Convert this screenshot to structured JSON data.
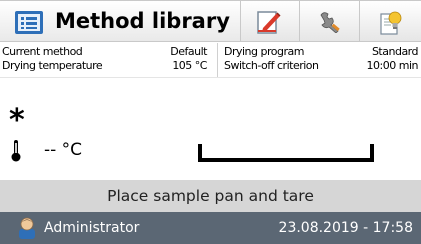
{
  "toolbar": {
    "title": "Method library",
    "icons": [
      "method-library-icon",
      "edit-pencil-icon",
      "wrench-icon",
      "info-bulb-icon"
    ]
  },
  "info_panel": {
    "current_method_label": "Current method",
    "current_method_value": "Default",
    "drying_temperature_label": "Drying temperature",
    "drying_temperature_value": "105 °C",
    "drying_program_label": "Drying program",
    "drying_program_value": "Standard",
    "switch_off_label": "Switch-off criterion",
    "switch_off_value": "10:00 min"
  },
  "main": {
    "asterisk": "*",
    "temperature_reading": "-- °C"
  },
  "instruction": "Place sample pan and tare",
  "status_bar": {
    "user": "Administrator",
    "datetime": "23.08.2019 - 17:58"
  },
  "colors": {
    "status_bar_bg": "#5b6774",
    "instruction_bg": "#d6d6d6",
    "edit_icon_red": "#d93a2b",
    "library_icon_blue": "#2e6fb8"
  }
}
